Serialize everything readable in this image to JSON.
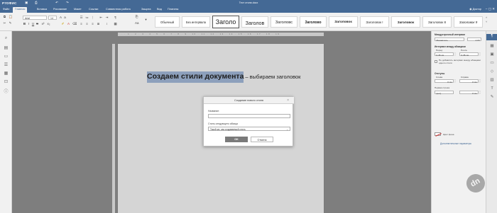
{
  "titlebar": {
    "logo": "Р7ОФИС",
    "doc_title": "Тест стили.docx",
    "save_icon": "save-icon",
    "print_icon": "print-icon",
    "undo_icon": "undo-icon",
    "redo_icon": "redo-icon"
  },
  "menu": {
    "tabs": [
      "Файл",
      "Главная",
      "Вставка",
      "Рисование",
      "Макет",
      "Ссылки",
      "Совместная работа",
      "Защита",
      "Вид",
      "Плагины"
    ],
    "active_tab": "Главная",
    "user": "Доктор"
  },
  "toolbar": {
    "font_name": "Arial",
    "font_size": "14"
  },
  "style_gallery": {
    "items": [
      "Обычный",
      "Без интервала",
      "Заголо",
      "Заголов",
      "Заголовс",
      "Заголово",
      "Заголовок",
      "Заголовок !",
      "Заголовок",
      "Заголовок 8",
      "Заголовок 9"
    ],
    "selected_index": 2
  },
  "document": {
    "heading_bold": "Создаем стили документа",
    "heading_rest": "– выбираем заголовок"
  },
  "dialog": {
    "title": "Создание нового стиля",
    "name_label": "Название:",
    "name_value": "",
    "next_style_label": "Стиль следующего абзаца",
    "next_style_value": "Такой же, как создаваемый стиль",
    "ok_label": "OK",
    "cancel_label": "Отмена"
  },
  "right_panel": {
    "line_spacing_title": "Междустрочный интервал",
    "line_spacing_mode": "Множитель",
    "line_spacing_value": "1.15",
    "para_spacing_title": "Интервал между абзацами",
    "before_label": "Перед",
    "after_label": "После",
    "before_value": "0.35 см",
    "after_value": "0.35 см",
    "no_interval_label": "Не добавлять интервал между абзацами одного стиля",
    "indents_title": "Отступы",
    "left_label": "Слева",
    "right_label": "Справа",
    "left_value": "0 см",
    "right_value": "0 см",
    "first_line_label": "Первая строка",
    "first_line_mode": "(нет)",
    "first_line_value": "0 см",
    "bg_color_label": "Цвет фона",
    "advanced_link": "Дополнительные параметры"
  },
  "watermark": {
    "text": "dn"
  },
  "colors": {
    "brand": "#446995",
    "heading_highlight": "#9db5d8",
    "ok_button": "#7a7a7a"
  }
}
